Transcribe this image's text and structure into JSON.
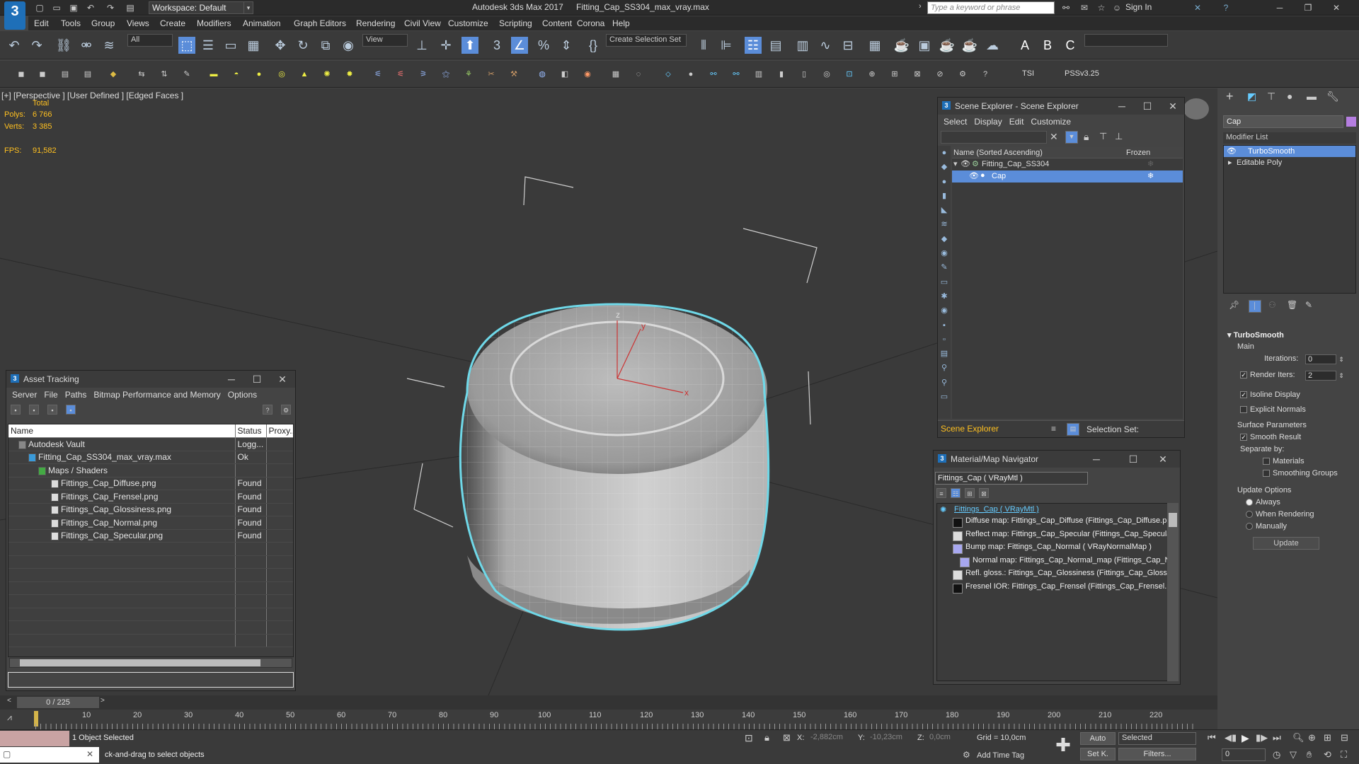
{
  "titlebar": {
    "app_title": "Autodesk 3ds Max 2017",
    "file_title": "Fitting_Cap_SS304_max_vray.max",
    "workspace": "Workspace: Default",
    "search_placeholder": "Type a keyword or phrase",
    "sign_in": "Sign In"
  },
  "menubar": [
    "Edit",
    "Tools",
    "Group",
    "Views",
    "Create",
    "Modifiers",
    "Animation",
    "Graph Editors",
    "Rendering",
    "Civil View",
    "Customize",
    "Scripting",
    "Content",
    "Corona",
    "Help"
  ],
  "toolbar": {
    "filter": "All",
    "view": "View",
    "selection_set": "Create Selection Set",
    "tsi": "TSI",
    "pss": "PSSv3.25"
  },
  "viewport": {
    "label": "[+] [Perspective ]  [User Defined ]  [Edged Faces ]",
    "total": "Total",
    "polys_label": "Polys:",
    "polys_value": "6 766",
    "verts_label": "Verts:",
    "verts_value": "3 385",
    "fps_label": "FPS:",
    "fps_value": "91,582",
    "axis_x": "x",
    "axis_y": "y",
    "axis_z": "z"
  },
  "asset_tracking": {
    "title": "Asset Tracking",
    "menu": [
      "Server",
      "File",
      "Paths",
      "Bitmap Performance and Memory",
      "Options"
    ],
    "columns": [
      "Name",
      "Status",
      "Proxy..."
    ],
    "rows": [
      {
        "name": "Autodesk Vault",
        "status": "Logg...",
        "indent": 0
      },
      {
        "name": "Fitting_Cap_SS304_max_vray.max",
        "status": "Ok",
        "indent": 1
      },
      {
        "name": "Maps / Shaders",
        "status": "",
        "indent": 2
      },
      {
        "name": "Fittings_Cap_Diffuse.png",
        "status": "Found",
        "indent": 3
      },
      {
        "name": "Fittings_Cap_Frensel.png",
        "status": "Found",
        "indent": 3
      },
      {
        "name": "Fittings_Cap_Glossiness.png",
        "status": "Found",
        "indent": 3
      },
      {
        "name": "Fittings_Cap_Normal.png",
        "status": "Found",
        "indent": 3
      },
      {
        "name": "Fittings_Cap_Specular.png",
        "status": "Found",
        "indent": 3
      }
    ]
  },
  "scene_explorer": {
    "title": "Scene Explorer - Scene Explorer",
    "menu": [
      "Select",
      "Display",
      "Edit",
      "Customize"
    ],
    "col_name": "Name (Sorted Ascending)",
    "col_frozen": "Frozen",
    "items": [
      {
        "name": "Fitting_Cap_SS304",
        "selected": false
      },
      {
        "name": "Cap",
        "selected": true
      }
    ],
    "footer_label": "Scene Explorer",
    "selection_set": "Selection Set:"
  },
  "material_navigator": {
    "title": "Material/Map Navigator",
    "field": "Fittings_Cap  ( VRayMtl )",
    "root": "Fittings_Cap  ( VRayMtl )",
    "rows": [
      {
        "text": "Diffuse map: Fittings_Cap_Diffuse (Fittings_Cap_Diffuse.png)",
        "swatch": "#111111"
      },
      {
        "text": "Reflect map: Fittings_Cap_Specular (Fittings_Cap_Specular.p",
        "swatch": "#dddddd"
      },
      {
        "text": "Bump map: Fittings_Cap_Normal  ( VRayNormalMap )",
        "swatch": "#a8a8f0"
      },
      {
        "text": "Normal map: Fittings_Cap_Normal_map (Fittings_Cap_Norm",
        "swatch": "#a8a8f0"
      },
      {
        "text": "Refl. gloss.: Fittings_Cap_Glossiness (Fittings_Cap_Glossiness.",
        "swatch": "#dddddd"
      },
      {
        "text": "Fresnel IOR: Fittings_Cap_Frensel (Fittings_Cap_Frensel.png)",
        "swatch": "#111111"
      }
    ]
  },
  "command_panel": {
    "object_name": "Cap",
    "modifier_list": "Modifier List",
    "stack": [
      {
        "name": "TurboSmooth",
        "selected": true
      },
      {
        "name": "Editable Poly",
        "selected": false
      }
    ],
    "rollout_title": "TurboSmooth",
    "main": "Main",
    "iterations_label": "Iterations:",
    "iterations_value": "0",
    "render_iters_label": "Render Iters:",
    "render_iters_value": "2",
    "isoline": "Isoline Display",
    "explicit_normals": "Explicit Normals",
    "surface_params": "Surface Parameters",
    "smooth_result": "Smooth Result",
    "separate_by": "Separate by:",
    "materials": "Materials",
    "smoothing_groups": "Smoothing Groups",
    "update_options": "Update Options",
    "always": "Always",
    "when_rendering": "When Rendering",
    "manually": "Manually",
    "update_button": "Update"
  },
  "timeline": {
    "frame": "0 / 225",
    "ticks": [
      "10",
      "20",
      "30",
      "40",
      "50",
      "60",
      "70",
      "80",
      "90",
      "100",
      "110",
      "120",
      "130",
      "140",
      "150",
      "160",
      "170",
      "180",
      "190",
      "200",
      "210",
      "220"
    ]
  },
  "status": {
    "objects_selected": "1 Object Selected",
    "prompt": "ck-and-drag to select objects",
    "x_label": "X:",
    "x_value": "-2,882cm",
    "y_label": "Y:",
    "y_value": "-10,23cm",
    "z_label": "Z:",
    "z_value": "0,0cm",
    "grid": "Grid = 10,0cm",
    "add_time_tag": "Add Time Tag",
    "auto": "Auto",
    "selected": "Selected",
    "set_key": "Set K.",
    "filters": "Filters...",
    "frame_field": "0"
  },
  "colors": {
    "selection": "#5b8dd9",
    "highlight": "#6fd8e8",
    "stats": "#ffc020"
  }
}
